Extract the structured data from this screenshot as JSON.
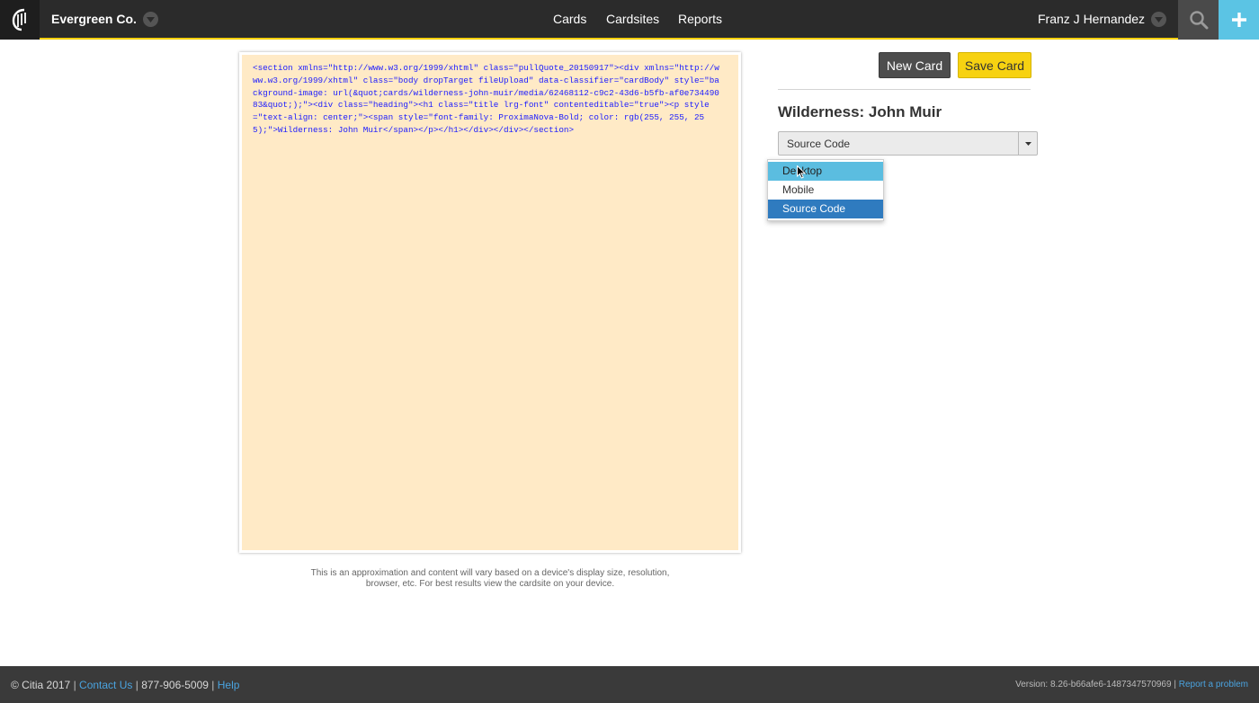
{
  "app": {
    "org_name": "Evergreen Co.",
    "nav": [
      "Cards",
      "Cardsites",
      "Reports"
    ],
    "user_name": "Franz J Hernandez",
    "colors": {
      "topbar": "#2b2b2b",
      "accent_yellow": "#f5cf00",
      "add_blue": "#5bc4e4"
    },
    "icons": [
      "citia-logo-icon",
      "chevron-down-icon",
      "search-icon",
      "plus-icon"
    ]
  },
  "editor": {
    "source_code": "<section xmlns=\"http://www.w3.org/1999/xhtml\" class=\"pullQuote_20150917\"><div xmlns=\"http://www.w3.org/1999/xhtml\" class=\"body dropTarget fileUpload\" data-classifier=\"cardBody\" style=\"background-image: url(&quot;cards/wilderness-john-muir/media/62468112-c9c2-43d6-b5fb-af0e73449083&quot;);\"><div class=\"heading\"><h1 class=\"title lrg-font\" contenteditable=\"true\"><p style=\"text-align: center;\"><span style=\"font-family: ProximaNova-Bold; color: rgb(255, 255, 255);\">Wilderness: John Muir</span></p></h1></div></div></section>",
    "disclaimer_line1": "This is an approximation and content will vary based on a device's display size, resolution,",
    "disclaimer_line2": "browser, etc. For best results view the cardsite on your device."
  },
  "panel": {
    "new_card_label": "New Card",
    "save_card_label": "Save Card",
    "card_title": "Wilderness: John Muir",
    "view_select": {
      "value": "Source Code",
      "options": [
        "Desktop",
        "Mobile",
        "Source Code"
      ],
      "hovered": "Desktop"
    }
  },
  "footer": {
    "copyright": "© Citia 2017",
    "contact_label": "Contact Us",
    "phone": "877-906-5009",
    "help_label": "Help",
    "version": "Version: 8.26-b66afe6-1487347570969",
    "report_label": "Report a problem"
  }
}
